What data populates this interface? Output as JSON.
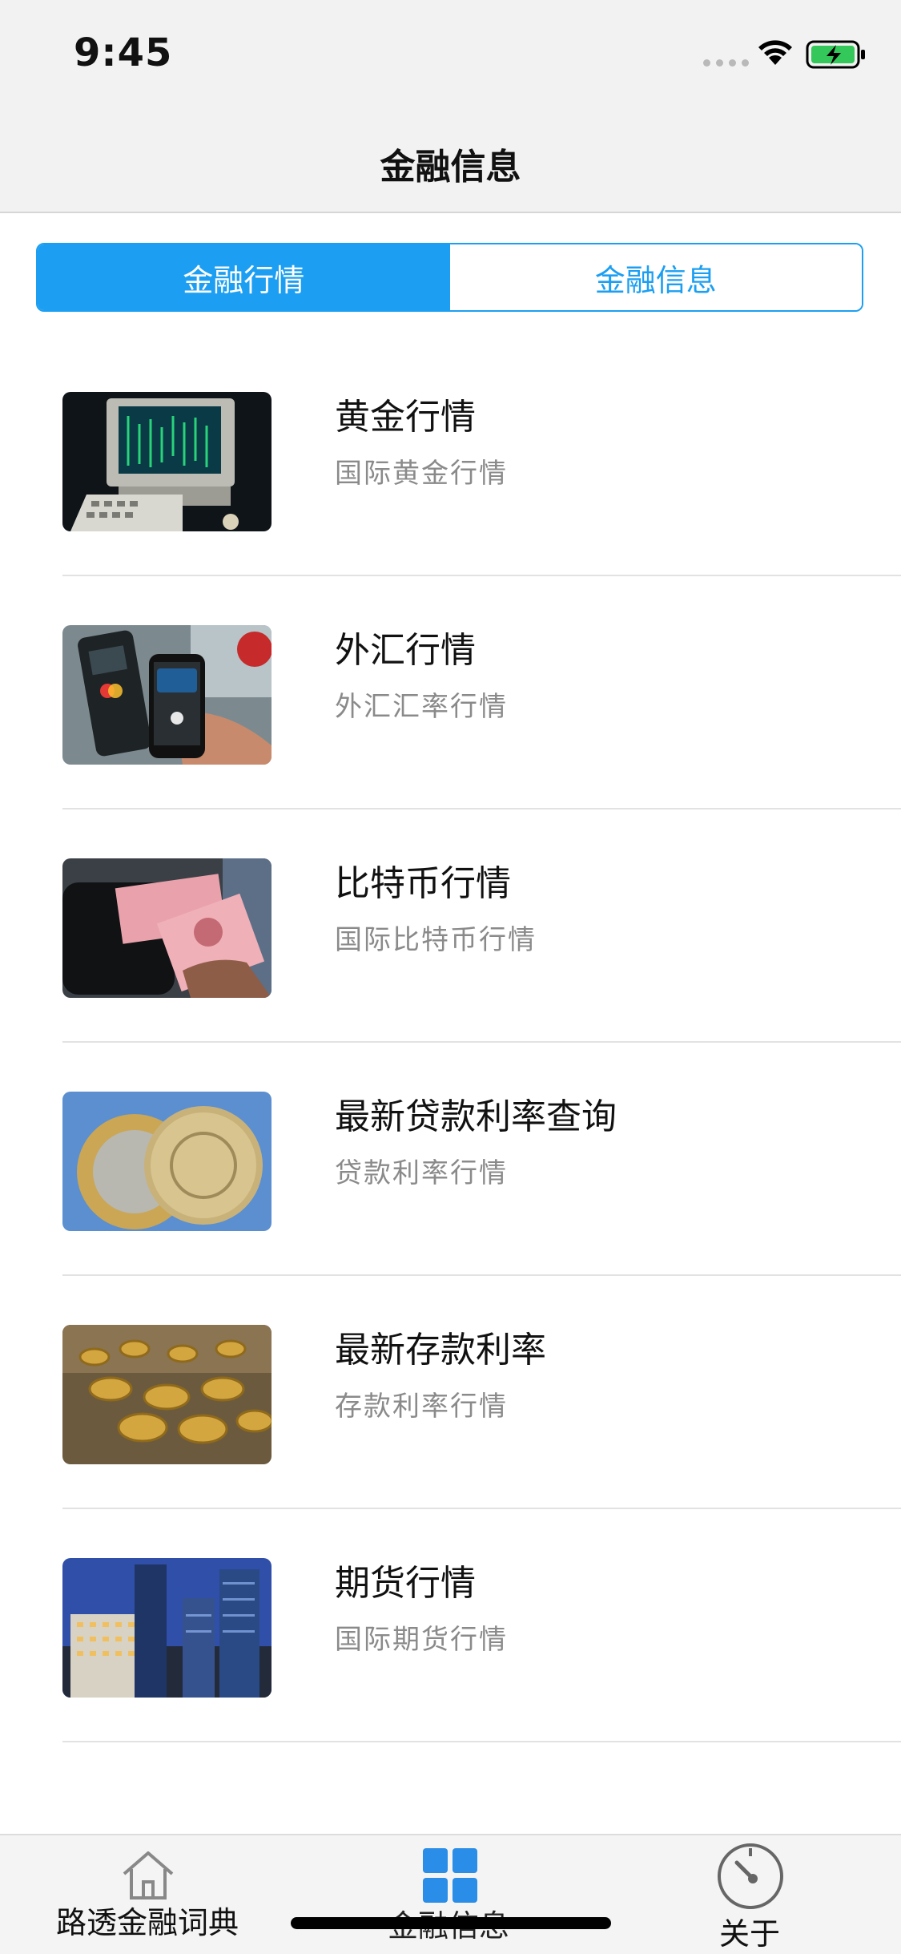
{
  "status_bar": {
    "time": "9:45"
  },
  "nav": {
    "title": "金融信息"
  },
  "segmented": {
    "left": "金融行情",
    "right": "金融信息"
  },
  "items": [
    {
      "title": "黄金行情",
      "subtitle": "国际黄金行情",
      "image": "computer-terminal"
    },
    {
      "title": "外汇行情",
      "subtitle": "外汇汇率行情",
      "image": "card-payment"
    },
    {
      "title": "比特币行情",
      "subtitle": "国际比特币行情",
      "image": "yuan-banknotes"
    },
    {
      "title": "最新贷款利率查询",
      "subtitle": "贷款利率行情",
      "image": "coins"
    },
    {
      "title": "最新存款利率",
      "subtitle": "存款利率行情",
      "image": "bitcoins"
    },
    {
      "title": "期货行情",
      "subtitle": "国际期货行情",
      "image": "city-buildings"
    }
  ],
  "tabbar": {
    "tabs": [
      {
        "label": "路透金融词典",
        "icon": "home-icon"
      },
      {
        "label": "金融信息",
        "icon": "grid-icon"
      },
      {
        "label": "关于",
        "icon": "compass-icon"
      }
    ]
  },
  "colors": {
    "accent": "#1c9ff2",
    "subtitle": "#8a8a8a",
    "tab_active": "#2a8de8"
  }
}
